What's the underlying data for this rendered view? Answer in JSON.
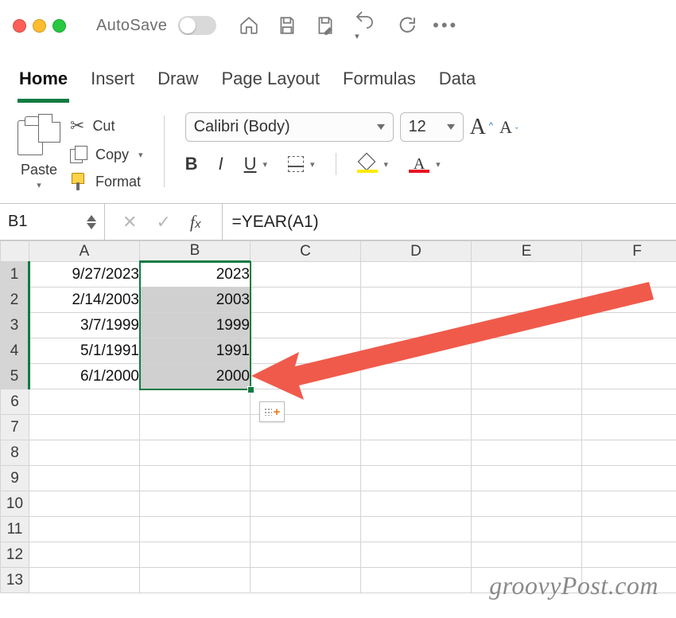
{
  "titlebar": {
    "autosave_label": "AutoSave"
  },
  "tabs": [
    "Home",
    "Insert",
    "Draw",
    "Page Layout",
    "Formulas",
    "Data"
  ],
  "active_tab": 0,
  "ribbon": {
    "paste": "Paste",
    "cut": "Cut",
    "copy": "Copy",
    "format": "Format",
    "font_name": "Calibri (Body)",
    "font_size": "12"
  },
  "namebox": "B1",
  "formula": "=YEAR(A1)",
  "columns": [
    "A",
    "B",
    "C",
    "D",
    "E",
    "F"
  ],
  "rows": [
    {
      "n": "1",
      "A": "9/27/2023",
      "B": "2023"
    },
    {
      "n": "2",
      "A": "2/14/2003",
      "B": "2003"
    },
    {
      "n": "3",
      "A": "3/7/1999",
      "B": "1999"
    },
    {
      "n": "4",
      "A": "5/1/1991",
      "B": "1991"
    },
    {
      "n": "5",
      "A": "6/1/2000",
      "B": "2000"
    },
    {
      "n": "6"
    },
    {
      "n": "7"
    },
    {
      "n": "8"
    },
    {
      "n": "9"
    },
    {
      "n": "10"
    },
    {
      "n": "11"
    },
    {
      "n": "12"
    },
    {
      "n": "13"
    }
  ],
  "selection": {
    "col": "B",
    "row_start": 1,
    "row_end": 5
  },
  "watermark": "groovyPost.com"
}
